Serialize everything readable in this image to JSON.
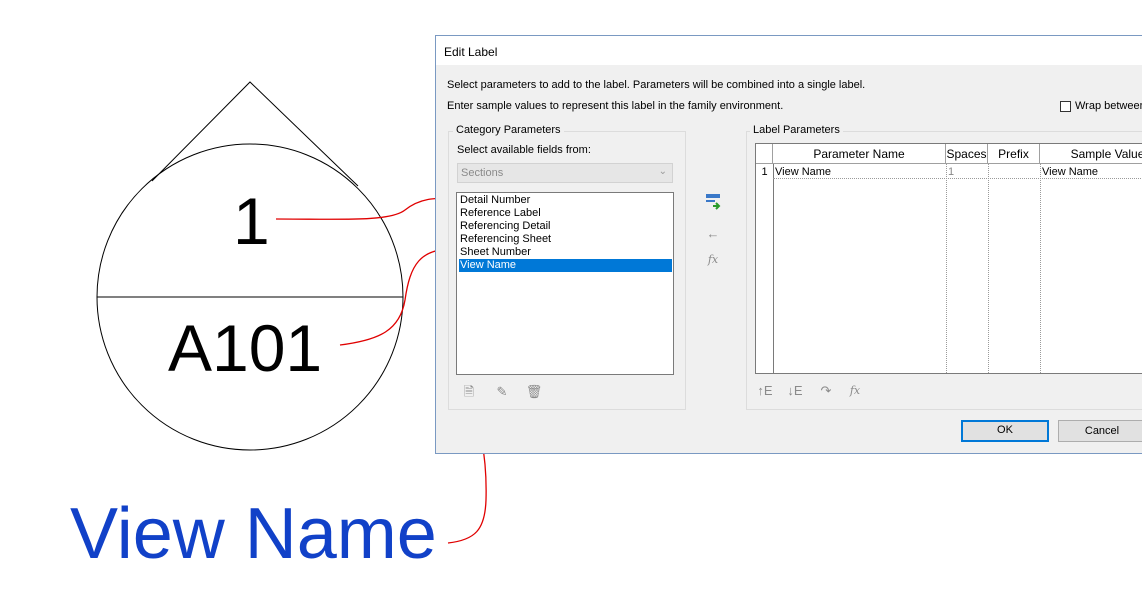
{
  "tag": {
    "detail_number": "1",
    "sheet_number": "A101",
    "view_name": "View Name"
  },
  "dialog": {
    "title": "Edit Label",
    "instruction_1": "Select parameters to add to the label.  Parameters will be combined into a single label.",
    "instruction_2": "Enter sample values to represent this label in the family environment.",
    "wrap_label": "Wrap between",
    "wrap_checked": false,
    "category_group_title": "Category Parameters",
    "select_from_label": "Select available fields from:",
    "select_value": "Sections",
    "fields": [
      "Detail Number",
      "Reference Label",
      "Referencing Detail",
      "Referencing Sheet",
      "Sheet Number",
      "View Name"
    ],
    "selected_field": "View Name",
    "label_group_title": "Label Parameters",
    "columns": [
      "Parameter Name",
      "Spaces",
      "Prefix",
      "Sample Value"
    ],
    "rows": [
      {
        "num": "1",
        "parameter_name": "View Name",
        "spaces": "1",
        "prefix": "",
        "sample_value": "View Name"
      }
    ],
    "ok_label": "OK",
    "cancel_label": "Cancel"
  },
  "colors": {
    "selection": "#0078d7",
    "annotation_line": "#e00000",
    "view_name_text": "#1141c8",
    "dialog_bg": "#f0f0f0"
  },
  "icons": [
    "add-parameter-icon",
    "remove-parameter-icon",
    "fx-icon",
    "new-parameter-icon",
    "edit-parameter-icon",
    "delete-parameter-icon",
    "move-up-icon",
    "move-down-icon",
    "sort-icon",
    "fx-edit-icon"
  ]
}
